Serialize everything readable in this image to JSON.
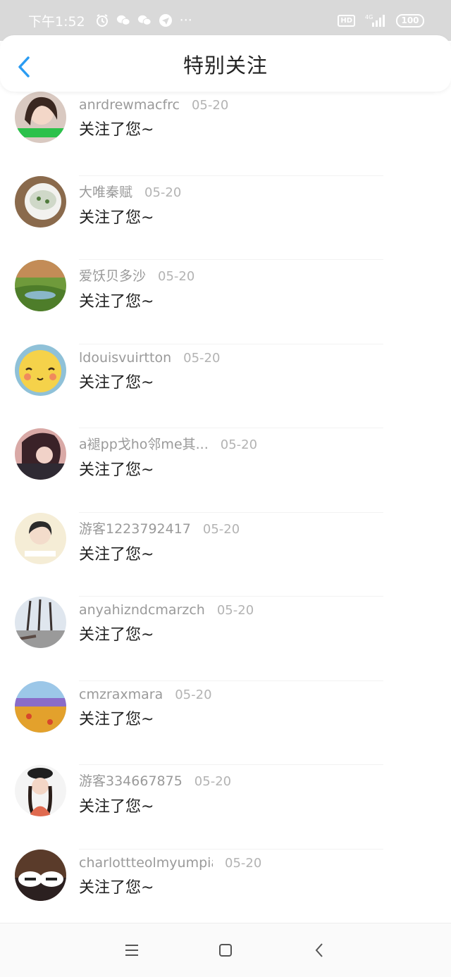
{
  "status_bar": {
    "time": "下午1:52",
    "more": "···",
    "network": "4G",
    "hd": "HD",
    "battery": "100"
  },
  "header": {
    "title": "特别关注"
  },
  "colors": {
    "accent": "#2b9cf2",
    "status_bg": "#d9d9d9",
    "name_gray": "#9a9a9a",
    "date_gray": "#b3b3b3"
  },
  "items": [
    {
      "name": "anrdrewmacfrc",
      "date": "05-20",
      "message": "关注了您~"
    },
    {
      "name": "大唯秦赋",
      "date": "05-20",
      "message": "关注了您~"
    },
    {
      "name": "爱饫贝多沙",
      "date": "05-20",
      "message": "关注了您~"
    },
    {
      "name": "ldouisvuirtton",
      "date": "05-20",
      "message": "关注了您~"
    },
    {
      "name": "a褪pp戈ho邻me其...",
      "date": "05-20",
      "message": "关注了您~"
    },
    {
      "name": "游客1223792417",
      "date": "05-20",
      "message": "关注了您~"
    },
    {
      "name": "anyahizndcmarzch",
      "date": "05-20",
      "message": "关注了您~"
    },
    {
      "name": "cmzraxmara",
      "date": "05-20",
      "message": "关注了您~"
    },
    {
      "name": "游客334667875",
      "date": "05-20",
      "message": "关注了您~"
    },
    {
      "name": "charlottteolmyumpia",
      "date": "05-20",
      "message": "关注了您~"
    }
  ]
}
